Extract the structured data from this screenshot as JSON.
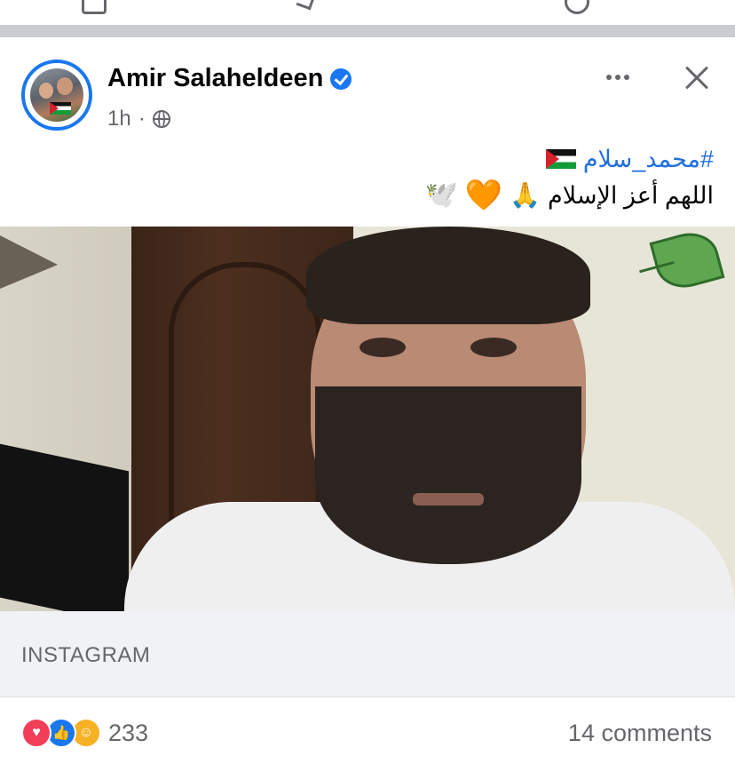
{
  "post": {
    "author": "Amir Salaheldeen",
    "time": "1h",
    "separator": "·",
    "hashtag": "#محمد_سلام",
    "text": "اللهم أعز الإسلام",
    "emojis": {
      "pray": "🙏",
      "heart": "🧡",
      "dove": "🕊️"
    },
    "link_source": "INSTAGRAM",
    "reactions_count": "233",
    "comments": "14 comments"
  },
  "colors": {
    "accent": "#1877f2",
    "hashtag": "#216fdb",
    "muted": "#65676b",
    "divider": "#c9ccd1"
  },
  "icons": [
    "verified-badge-icon",
    "globe-icon",
    "more-options-icon",
    "close-icon",
    "palestine-flag-icon",
    "love-reaction-icon",
    "like-reaction-icon",
    "care-reaction-icon"
  ]
}
